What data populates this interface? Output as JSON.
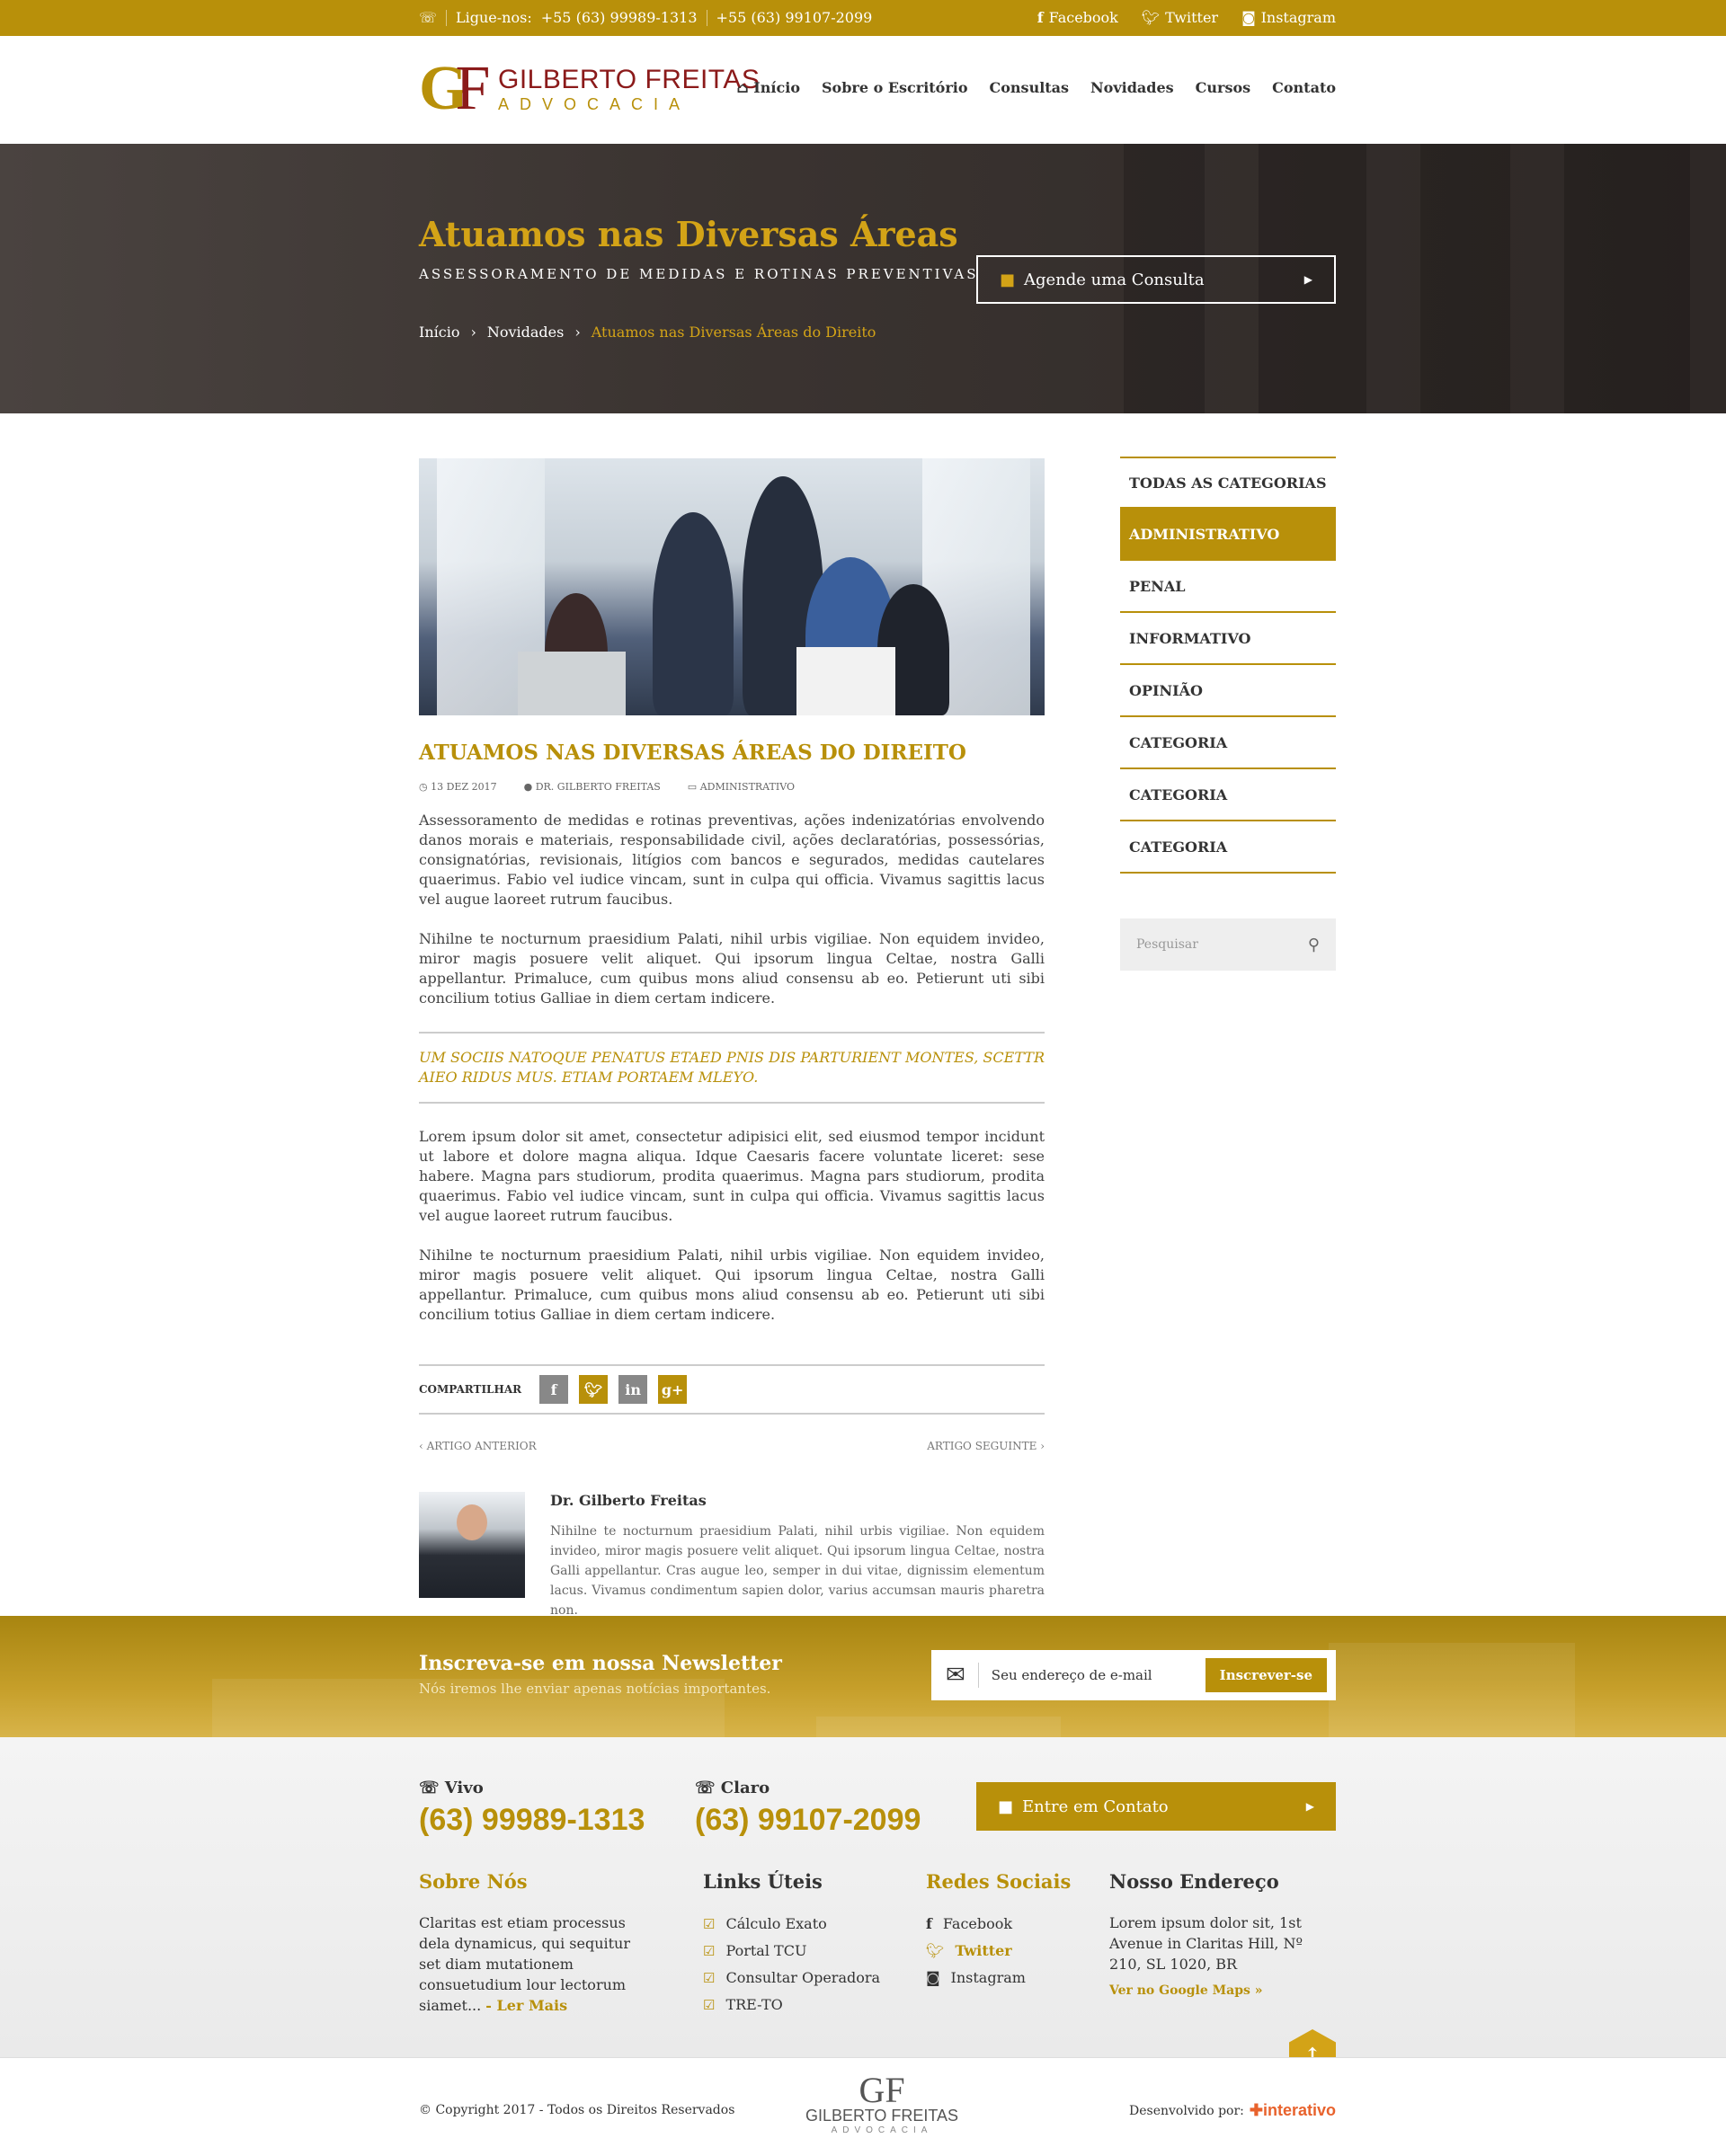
{
  "topbar": {
    "phone_label": "Ligue-nos:",
    "phone1": "+55 (63) 99989-1313",
    "phone2": "+55 (63) 99107-2099",
    "social": [
      {
        "label": "Facebook",
        "icon": "facebook-icon"
      },
      {
        "label": "Twitter",
        "icon": "twitter-icon"
      },
      {
        "label": "Instagram",
        "icon": "instagram-icon"
      }
    ]
  },
  "logo": {
    "mark_g": "G",
    "mark_f": "F",
    "line1": "GILBERTO FREITAS",
    "line2": "ADVOCACIA"
  },
  "nav": [
    "Início",
    "Sobre o Escritório",
    "Consultas",
    "Novidades",
    "Cursos",
    "Contato"
  ],
  "hero": {
    "title": "Atuamos nas Diversas Áreas",
    "subtitle": "ASSESSORAMENTO DE MEDIDAS E ROTINAS PREVENTIVAS",
    "cta": "Agende uma Consulta",
    "breadcrumb": [
      "Início",
      "Novidades",
      "Atuamos nas Diversas Áreas do Direito"
    ]
  },
  "article": {
    "title": "ATUAMOS NAS DIVERSAS ÁREAS DO DIREITO",
    "date": "13 DEZ 2017",
    "author": "DR. GILBERTO FREITAS",
    "category": "ADMINISTRATIVO",
    "p1": "Assessoramento de medidas e rotinas preventivas, ações indenizatórias envolvendo danos morais e materiais, responsabilidade civil, ações declaratórias, possessórias, consignatórias, revisionais, litígios com bancos e segurados, medidas cautelares quaerimus. Fabio vel iudice vincam, sunt in culpa qui officia. Vivamus sagittis lacus vel augue laoreet rutrum faucibus.",
    "p2": "Nihilne te nocturnum praesidium Palati, nihil urbis vigiliae. Non equidem invideo, miror magis posuere velit aliquet. Qui ipsorum lingua Celtae, nostra Galli appellantur. Primaluce, cum quibus mons aliud consensu ab eo. Petierunt uti sibi concilium totius Galliae in diem certam indicere.",
    "quote": "UM SOCIIS NATOQUE PENATUS ETAED PNIS DIS PARTURIENT MONTES, SCETTR AIEO RIDUS MUS. ETIAM PORTAEM MLEYO.",
    "p3": "Lorem ipsum dolor sit amet, consectetur adipisici elit, sed eiusmod tempor incidunt ut labore et dolore magna aliqua. Idque Caesaris facere voluntate liceret: sese habere. Magna pars studiorum, prodita quaerimus. Magna pars studiorum, prodita quaerimus. Fabio vel iudice vincam, sunt in culpa qui officia. Vivamus sagittis lacus vel augue laoreet rutrum faucibus.",
    "p4": "Nihilne te nocturnum praesidium Palati, nihil urbis vigiliae. Non equidem invideo, miror magis posuere velit aliquet. Qui ipsorum lingua Celtae, nostra Galli appellantur. Primaluce, cum quibus mons aliud consensu ab eo. Petierunt uti sibi concilium totius Galliae in diem certam indicere.",
    "share_label": "COMPARTILHAR",
    "share_icons": [
      "f",
      "t",
      "in",
      "g+"
    ],
    "prev": "ARTIGO ANTERIOR",
    "next": "ARTIGO SEGUINTE",
    "author_name": "Dr. Gilberto Freitas",
    "author_bio": "Nihilne te nocturnum praesidium Palati, nihil urbis vigiliae. Non equidem invideo, miror magis posuere velit aliquet. Qui ipsorum lingua Celtae, nostra Galli appellantur. Cras augue leo, semper in dui vitae, dignissim elementum lacus. Vivamus condimentum sapien dolor, varius accumsan mauris pharetra non."
  },
  "sidebar": {
    "categories": [
      "TODAS AS CATEGORIAS",
      "ADMINISTRATIVO",
      "PENAL",
      "INFORMATIVO",
      "OPINIÃO",
      "CATEGORIA",
      "CATEGORIA",
      "CATEGORIA"
    ],
    "active_index": 1,
    "search_placeholder": "Pesquisar"
  },
  "newsletter": {
    "title": "Inscreva-se em nossa Newsletter",
    "subtitle": "Nós iremos lhe enviar apenas notícias importantes.",
    "placeholder": "Seu endereço de e-mail",
    "button": "Inscrever-se"
  },
  "footer": {
    "vivo_label": "Vivo",
    "vivo_number": "(63) 99989-1313",
    "claro_label": "Claro",
    "claro_number": "(63) 99107-2099",
    "contact_button": "Entre em Contato",
    "about_title": "Sobre Nós",
    "about_text": "Claritas est etiam processus dela dynamicus, qui sequitur set diam mutationem consuetudium lour lectorum siamet...",
    "about_more": "- Ler Mais",
    "links_title": "Links Úteis",
    "links": [
      "Cálculo Exato",
      "Portal TCU",
      "Consultar Operadora",
      "TRE-TO"
    ],
    "social_title": "Redes Sociais",
    "social": [
      "Facebook",
      "Twitter",
      "Instagram"
    ],
    "address_title": "Nosso Endereço",
    "address": "Lorem ipsum dolor sit, 1st Avenue in Claritas Hill, Nº 210, SL 1020, BR",
    "maps_link": "Ver no Google Maps »",
    "copyright": "© Copyright 2017 - Todos os Direitos Reservados",
    "bottom_logo_mark": "GF",
    "bottom_logo_line1": "GILBERTO FREITAS",
    "bottom_logo_line2": "ADVOCACIA",
    "dev_label": "Desenvolvido por:",
    "dev_brand": "interativo"
  },
  "colors": {
    "accent": "#b8900a",
    "hero_title": "#d3a317",
    "dark": "#333333"
  }
}
